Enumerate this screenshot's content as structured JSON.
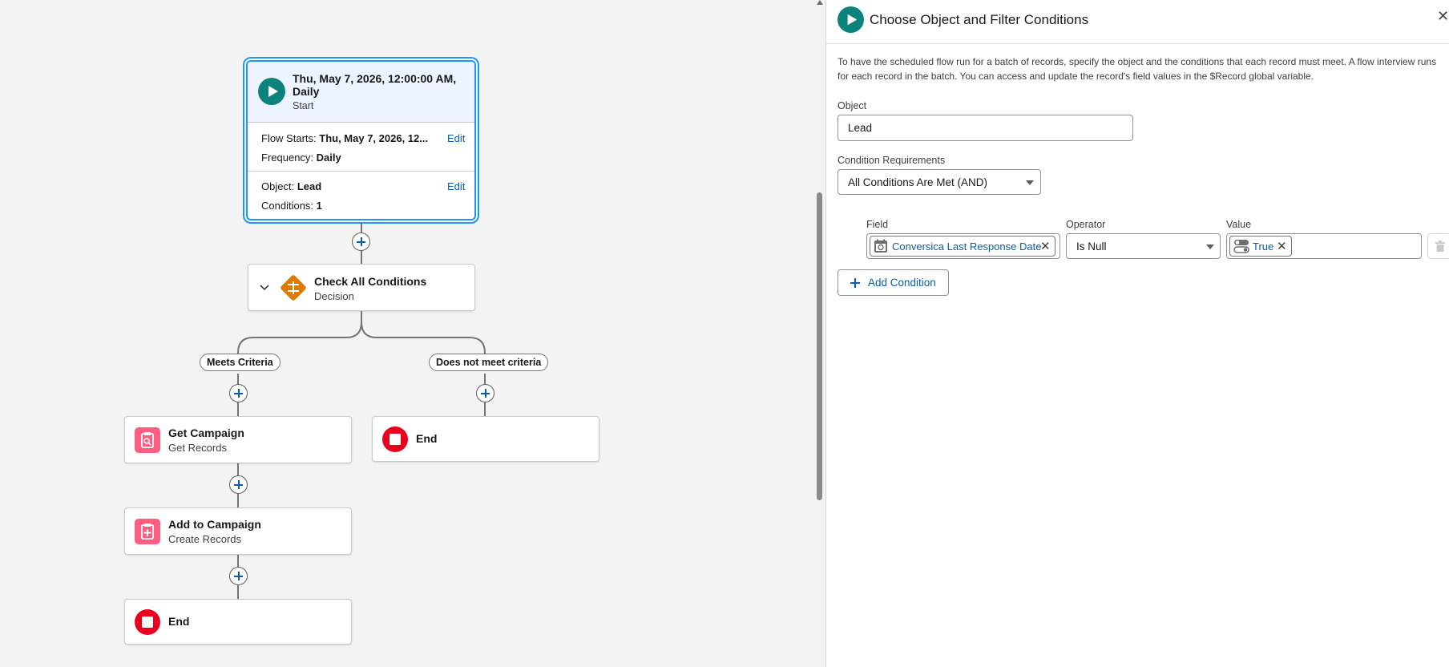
{
  "canvas": {
    "start": {
      "title": "Thu, May 7, 2026, 12:00:00 AM, Daily",
      "title_line1": "Thu, May 7, 2026, 12:00:00 AM,",
      "title_line2": "Daily",
      "subtitle": "Start",
      "flow_starts_label": "Flow Starts:",
      "flow_starts_value": "Thu, May 7, 2026, 12...",
      "frequency_label": "Frequency:",
      "frequency_value": "Daily",
      "object_label": "Object:",
      "object_value": "Lead",
      "conditions_label": "Conditions:",
      "conditions_value": "1",
      "edit_label": "Edit"
    },
    "decision": {
      "title": "Check All Conditions",
      "subtitle": "Decision"
    },
    "branches": {
      "left": "Meets Criteria",
      "right": "Does not meet criteria"
    },
    "get_campaign": {
      "title": "Get Campaign",
      "subtitle": "Get Records"
    },
    "add_campaign": {
      "title": "Add to Campaign",
      "subtitle": "Create Records"
    },
    "end_right": {
      "title": "End"
    },
    "end_left": {
      "title": "End"
    }
  },
  "panel": {
    "title": "Choose Object and Filter Conditions",
    "description": "To have the scheduled flow run for a batch of records, specify the object and the conditions that each record must meet. A flow interview runs for each record in the batch. You can access and update the record's field values in the $Record global variable.",
    "object_label": "Object",
    "object_value": "Lead",
    "cond_req_label": "Condition Requirements",
    "cond_req_value": "All Conditions Are Met (AND)",
    "field_header": "Field",
    "operator_header": "Operator",
    "value_header": "Value",
    "field_value": "Conversica Last Response Date",
    "operator_value": "Is Null",
    "value_value": "True",
    "add_condition_label": "Add Condition"
  },
  "colors": {
    "start_teal": "#0b827c",
    "decision_orange": "#dd7a01",
    "records_pink": "#ff5d81",
    "end_red": "#ea001e",
    "link_blue": "#0b5cab",
    "selection_blue": "#1b96ff"
  },
  "icons": {
    "start": "play-icon",
    "decision": "decision-icon",
    "get_records": "get-records-icon",
    "create_records": "create-records-icon",
    "end": "stop-icon",
    "field": "calendar-icon",
    "value": "toggle-icon"
  }
}
